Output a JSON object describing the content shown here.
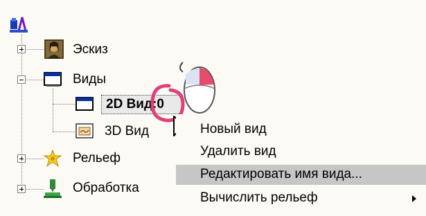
{
  "tree": {
    "root_icon": "model-root-icon",
    "nodes": [
      {
        "label": "Эскиз",
        "icon": "mona-lisa-icon",
        "expander": "plus"
      },
      {
        "label": "Виды",
        "icon": "window-icon",
        "expander": "minus"
      },
      {
        "label": "2D Вид:0",
        "icon": "window-icon",
        "selected": true
      },
      {
        "label": "3D Вид",
        "icon": "view3d-icon"
      },
      {
        "label": "Рельеф",
        "icon": "star-flower-icon",
        "expander": "plus"
      },
      {
        "label": "Обработка",
        "icon": "machining-icon",
        "expander": "plus"
      }
    ]
  },
  "context_menu": {
    "items": [
      {
        "label": "Новый вид"
      },
      {
        "label": "Удалить вид"
      },
      {
        "label": "Редактировать имя вида...",
        "highlighted": true
      },
      {
        "label": "Вычислить рельеф",
        "submenu": true
      }
    ]
  },
  "annotation": {
    "circle_color": "#e0407a",
    "mouse_icon": "right-click-mouse-icon",
    "cursor_icon": "arrow-cursor-icon"
  }
}
